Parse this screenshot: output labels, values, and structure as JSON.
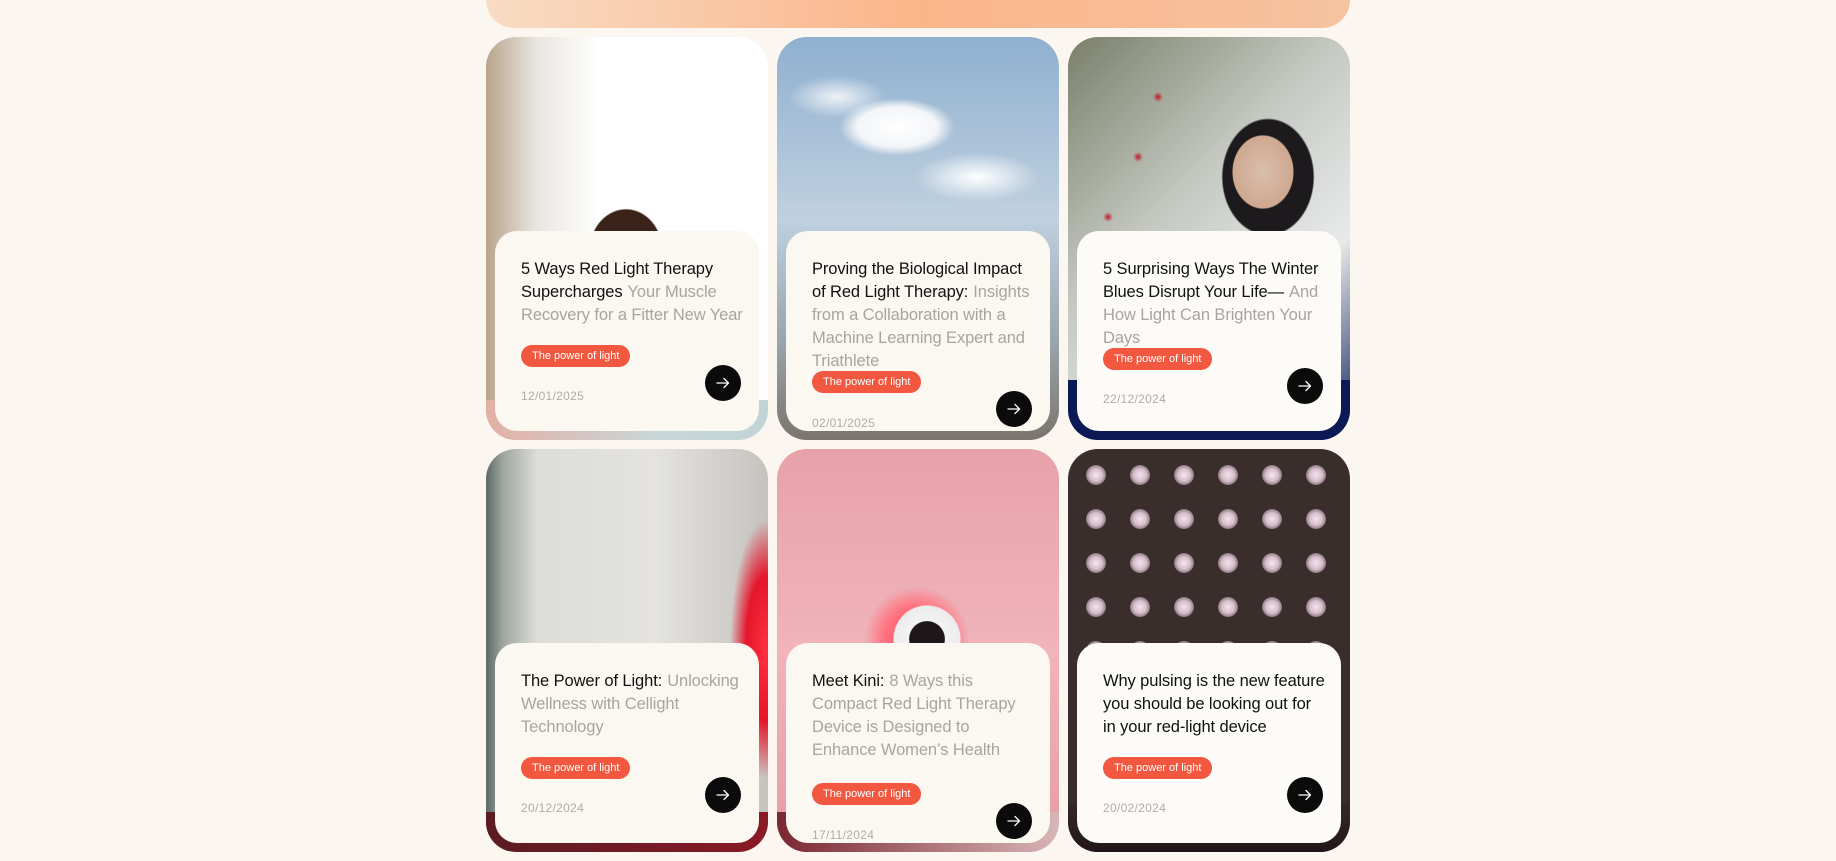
{
  "cards": [
    {
      "title_lead": "5 Ways Red Light Therapy Supercharges",
      "title_rest": "Your Muscle Recovery for a Fitter New Year",
      "tag": "The power of light",
      "date": "12/01/2025",
      "image": "woman-curly-hair-photo"
    },
    {
      "title_lead": "Proving the Biological Impact of Red Light Therapy:",
      "title_rest": "Insights from a Collaboration with a Machine Learning Expert and Triathlete",
      "tag": "The power of light",
      "date": "02/01/2025",
      "image": "cloudy-sky-cyclists-photo"
    },
    {
      "title_lead": "5 Surprising Ways The Winter Blues Disrupt Your Life—",
      "title_rest": "And How Light Can Brighten Your Days",
      "tag": "The power of light",
      "date": "22/12/2024",
      "image": "woman-winter-berries-photo"
    },
    {
      "title_lead": "The Power of Light:",
      "title_rest": "Unlocking Wellness with Cellight Technology",
      "tag": "The power of light",
      "date": "20/12/2024",
      "image": "red-light-wall-photo"
    },
    {
      "title_lead": "Meet Kini:",
      "title_rest": "8 Ways this Compact Red Light Therapy Device is Designed to Enhance Women’s Health",
      "tag": "The power of light",
      "date": "17/11/2024",
      "image": "pink-device-photo"
    },
    {
      "title_lead": "Why pulsing is the new feature you should be looking out for in your red-light device",
      "title_rest": "",
      "tag": "The power of light",
      "date": "20/02/2024",
      "image": "led-panel-photo"
    }
  ],
  "icons": {
    "arrow": "arrow-right-icon"
  },
  "colors": {
    "background": "#fbf6f0",
    "tag": "#f2573f",
    "button": "#0b0b0b",
    "title_lead": "#111111",
    "title_rest": "#a8a49f",
    "date": "#b0aca7"
  }
}
